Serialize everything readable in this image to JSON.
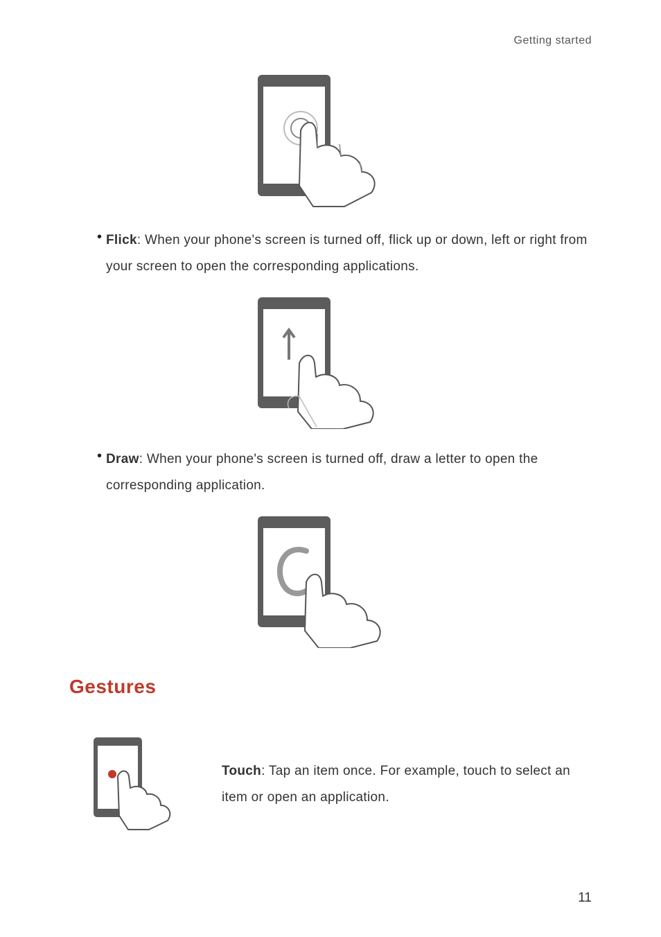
{
  "header": "Getting started",
  "bullets": {
    "flick": {
      "label": "Flick",
      "text": ": When your phone's screen is turned off, flick up or down, left or right from your screen to open the corresponding applications."
    },
    "draw": {
      "label": "Draw",
      "text": ": When your phone's screen is turned off, draw a letter to open the corresponding application."
    }
  },
  "section_title": "Gestures",
  "gestures": {
    "touch": {
      "label": "Touch",
      "text": ": Tap an item once. For example, touch to select an item or open an application."
    }
  },
  "page_number": "11"
}
